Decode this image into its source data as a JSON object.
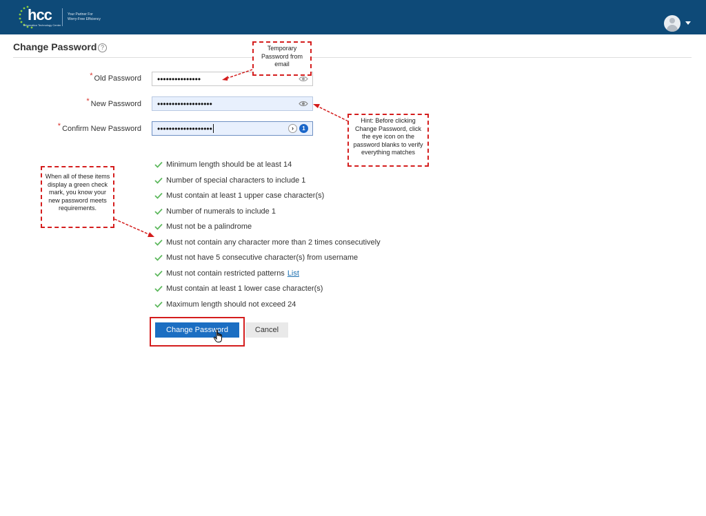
{
  "header": {
    "logo_text": "hcc",
    "logo_subtitle": "Information Technology Center",
    "tagline_line1": "Your Partner For",
    "tagline_line2": "Worry-Free Efficiency",
    "avatar_icon": "user-avatar-icon",
    "background_color": "#0e4a78"
  },
  "page": {
    "title": "Change Password",
    "help_glyph": "?"
  },
  "form": {
    "required_marker": "*",
    "old_password": {
      "label": "Old Password",
      "value": "•••••••••••••••"
    },
    "new_password": {
      "label": "New Password",
      "value": "•••••••••••••••••••"
    },
    "confirm_password": {
      "label": "Confirm New Password",
      "value": "•••••••••••••••••••"
    },
    "password_manager_arrow": "›",
    "password_manager_logo": "1"
  },
  "requirements": [
    "Minimum length should be at least 14",
    "Number of special characters to include 1",
    "Must contain at least 1 upper case character(s)",
    "Number of numerals to include 1",
    "Must not be a palindrome",
    "Must not contain any character more than 2 times consecutively",
    "Must not have 5 consecutive character(s) from username",
    "Must not contain restricted patterns",
    "Must contain at least 1 lower case character(s)",
    "Maximum length should not exceed 24"
  ],
  "requirements_link": "List",
  "buttons": {
    "change_password": "Change Password",
    "cancel": "Cancel"
  },
  "callouts": {
    "temporary_password": "Temporary Password from email",
    "hint": "Hint: Before clicking Change Password, click the eye icon on the password blanks to verify everything matches",
    "checkmarks": "When all of these items display a green check mark, you know your new password meets requirements."
  },
  "colors": {
    "accent": "#1b6ec2",
    "check": "#5cb85c",
    "annotation": "#d41c1c",
    "required": "#d9312a"
  }
}
